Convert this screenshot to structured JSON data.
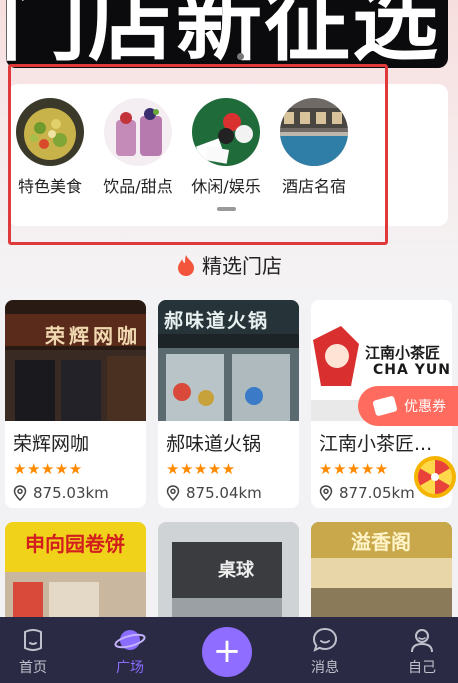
{
  "banner": {
    "text": "门店新征选"
  },
  "categories": [
    {
      "label": "特色美食",
      "icon": "salad-photo"
    },
    {
      "label": "饮品/甜点",
      "icon": "smoothie-photo"
    },
    {
      "label": "休闲/娱乐",
      "icon": "billiards-photo"
    },
    {
      "label": "酒店名宿",
      "icon": "pool-photo"
    }
  ],
  "section": {
    "title": "精选门店",
    "icon": "flame-icon"
  },
  "shops": [
    {
      "name": "荣辉网咖",
      "rating": 5,
      "stars": "★★★★★",
      "distance": "875.03km",
      "sign": "荣辉网咖"
    },
    {
      "name": "郝味道火锅",
      "rating": 5,
      "stars": "★★★★★",
      "distance": "875.04km",
      "sign": "郝味道火锅"
    },
    {
      "name": "江南小茶匠...",
      "rating": 5,
      "stars": "★★★★★",
      "distance": "877.05km",
      "sign": "江南小茶匠",
      "sign_sub": "CHA YUN"
    }
  ],
  "shops_row2": [
    {
      "sign": "申向园卷饼"
    },
    {
      "sign": "桌球"
    },
    {
      "sign": "溢香阁"
    }
  ],
  "coupon": {
    "label": "优惠券"
  },
  "tabbar": {
    "items": [
      {
        "label": "首页",
        "icon": "home-icon"
      },
      {
        "label": "广场",
        "icon": "planet-icon",
        "active": true
      },
      {
        "label": "",
        "icon": "plus-icon"
      },
      {
        "label": "消息",
        "icon": "chat-icon"
      },
      {
        "label": "自己",
        "icon": "profile-icon"
      }
    ],
    "plus": "+"
  },
  "colors": {
    "accent": "#8f6dff",
    "tabbar_bg": "#2a2a44",
    "star": "#ff8a00",
    "highlight": "#e0393b",
    "coupon": "#ff6b5e"
  }
}
